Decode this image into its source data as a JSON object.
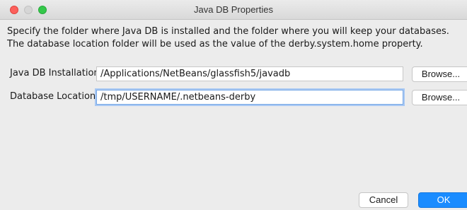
{
  "window": {
    "title": "Java DB Properties"
  },
  "description": "Specify the folder where Java DB is installed and the folder where you will keep your databases. The database location folder will be used as the value of the derby.system.home property.",
  "installation": {
    "label": "Java DB Installation:",
    "value": "/Applications/NetBeans/glassfish5/javadb",
    "browse_label": "Browse..."
  },
  "location": {
    "label": "Database Location:",
    "value": "/tmp/USERNAME/.netbeans-derby",
    "browse_label": "Browse..."
  },
  "footer": {
    "cancel_label": "Cancel",
    "ok_label": "OK"
  },
  "colors": {
    "accent": "#1a8cff",
    "close": "#fc605c",
    "maximize": "#34c84a"
  }
}
